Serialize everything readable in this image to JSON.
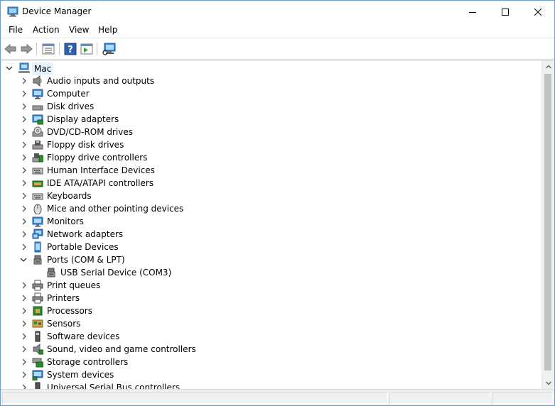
{
  "window": {
    "title": "Device Manager",
    "controls": {
      "minimize": "minimize",
      "maximize": "maximize",
      "close": "close"
    }
  },
  "menu": [
    {
      "label": "File"
    },
    {
      "label": "Action"
    },
    {
      "label": "View"
    },
    {
      "label": "Help"
    }
  ],
  "toolbar": {
    "buttons": [
      {
        "icon": "back-arrow-icon"
      },
      {
        "icon": "forward-arrow-icon"
      },
      {
        "icon": "properties-list-icon"
      },
      {
        "icon": "help-icon"
      },
      {
        "icon": "run-pane-icon"
      },
      {
        "icon": "computer-scan-icon"
      }
    ]
  },
  "tree": {
    "root": {
      "label": "Mac",
      "expanded": true,
      "selected": true,
      "icon": "computer-icon"
    },
    "categories": [
      {
        "label": "Audio inputs and outputs",
        "icon": "speaker-icon",
        "expanded": false
      },
      {
        "label": "Computer",
        "icon": "monitor-icon",
        "expanded": false
      },
      {
        "label": "Disk drives",
        "icon": "disk-drive-icon",
        "expanded": false
      },
      {
        "label": "Display adapters",
        "icon": "display-adapter-icon",
        "expanded": false
      },
      {
        "label": "DVD/CD-ROM drives",
        "icon": "dvd-icon",
        "expanded": false
      },
      {
        "label": "Floppy disk drives",
        "icon": "floppy-icon",
        "expanded": false
      },
      {
        "label": "Floppy drive controllers",
        "icon": "floppy-controller-icon",
        "expanded": false
      },
      {
        "label": "Human Interface Devices",
        "icon": "hid-icon",
        "expanded": false
      },
      {
        "label": "IDE ATA/ATAPI controllers",
        "icon": "ide-controller-icon",
        "expanded": false
      },
      {
        "label": "Keyboards",
        "icon": "keyboard-icon",
        "expanded": false
      },
      {
        "label": "Mice and other pointing devices",
        "icon": "mouse-icon",
        "expanded": false
      },
      {
        "label": "Monitors",
        "icon": "monitor-icon",
        "expanded": false
      },
      {
        "label": "Network adapters",
        "icon": "network-adapter-icon",
        "expanded": false
      },
      {
        "label": "Portable Devices",
        "icon": "portable-device-icon",
        "expanded": false
      },
      {
        "label": "Ports (COM & LPT)",
        "icon": "port-icon",
        "expanded": true,
        "children": [
          {
            "label": "USB Serial Device (COM3)",
            "icon": "port-icon"
          }
        ]
      },
      {
        "label": "Print queues",
        "icon": "printer-icon",
        "expanded": false
      },
      {
        "label": "Printers",
        "icon": "printer-icon",
        "expanded": false
      },
      {
        "label": "Processors",
        "icon": "processor-icon",
        "expanded": false
      },
      {
        "label": "Sensors",
        "icon": "sensor-icon",
        "expanded": false
      },
      {
        "label": "Software devices",
        "icon": "software-device-icon",
        "expanded": false
      },
      {
        "label": "Sound, video and game controllers",
        "icon": "sound-icon",
        "expanded": false
      },
      {
        "label": "Storage controllers",
        "icon": "storage-controller-icon",
        "expanded": false
      },
      {
        "label": "System devices",
        "icon": "system-device-icon",
        "expanded": false
      },
      {
        "label": "Universal Serial Bus controllers",
        "icon": "usb-icon",
        "expanded": false
      }
    ]
  },
  "colors": {
    "selection": "#e5f3ff",
    "window_border": "#6b9bd1",
    "status_bar": "#f0f0f0"
  }
}
